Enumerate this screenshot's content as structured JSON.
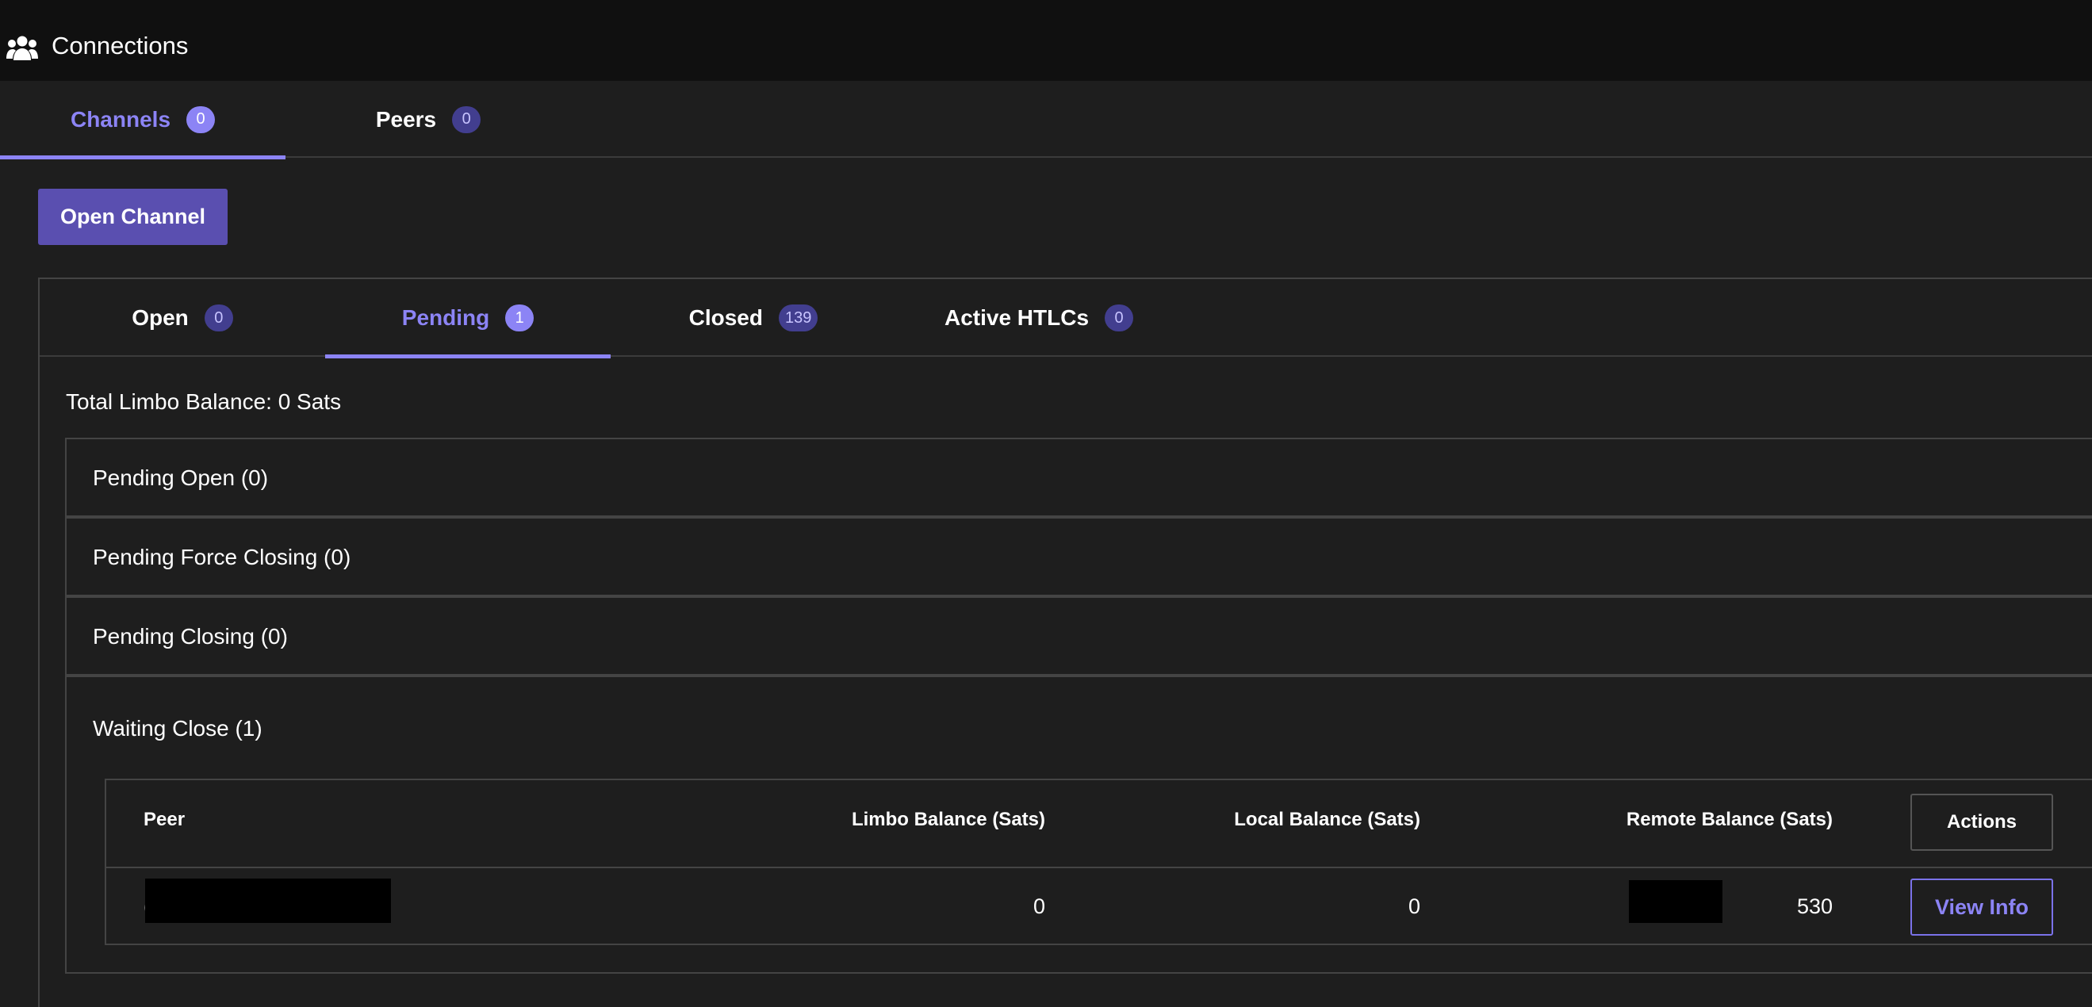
{
  "header": {
    "title": "Connections",
    "icon": "people-group-icon"
  },
  "main_tabs": [
    {
      "label": "Channels",
      "count": "0",
      "active": true
    },
    {
      "label": "Peers",
      "count": "0",
      "active": false
    }
  ],
  "open_channel_label": "Open Channel",
  "sub_tabs": [
    {
      "label": "Open",
      "count": "0",
      "active": false
    },
    {
      "label": "Pending",
      "count": "1",
      "active": true
    },
    {
      "label": "Closed",
      "count": "139",
      "active": false
    },
    {
      "label": "Active HTLCs",
      "count": "0",
      "active": false
    }
  ],
  "total_limbo_balance": "Total Limbo Balance: 0 Sats",
  "accordions": [
    {
      "label": "Pending Open (0)",
      "expanded": false
    },
    {
      "label": "Pending Force Closing (0)",
      "expanded": false
    },
    {
      "label": "Pending Closing (0)",
      "expanded": false
    },
    {
      "label": "Waiting Close (1)",
      "expanded": true
    }
  ],
  "waiting_close_table": {
    "columns": [
      "Peer",
      "Limbo Balance (Sats)",
      "Local Balance (Sats)",
      "Remote Balance (Sats)",
      "Actions"
    ],
    "rows": [
      {
        "peer": "(",
        "limbo_balance": "0",
        "local_balance": "0",
        "remote_balance": "530",
        "action": "View Info"
      }
    ]
  },
  "colors": {
    "accent": "#8c84f5",
    "button_bg": "#5a4fb0",
    "badge_bg": "#423e8f",
    "background": "#1e1e1e",
    "topbar_bg": "#101010"
  }
}
